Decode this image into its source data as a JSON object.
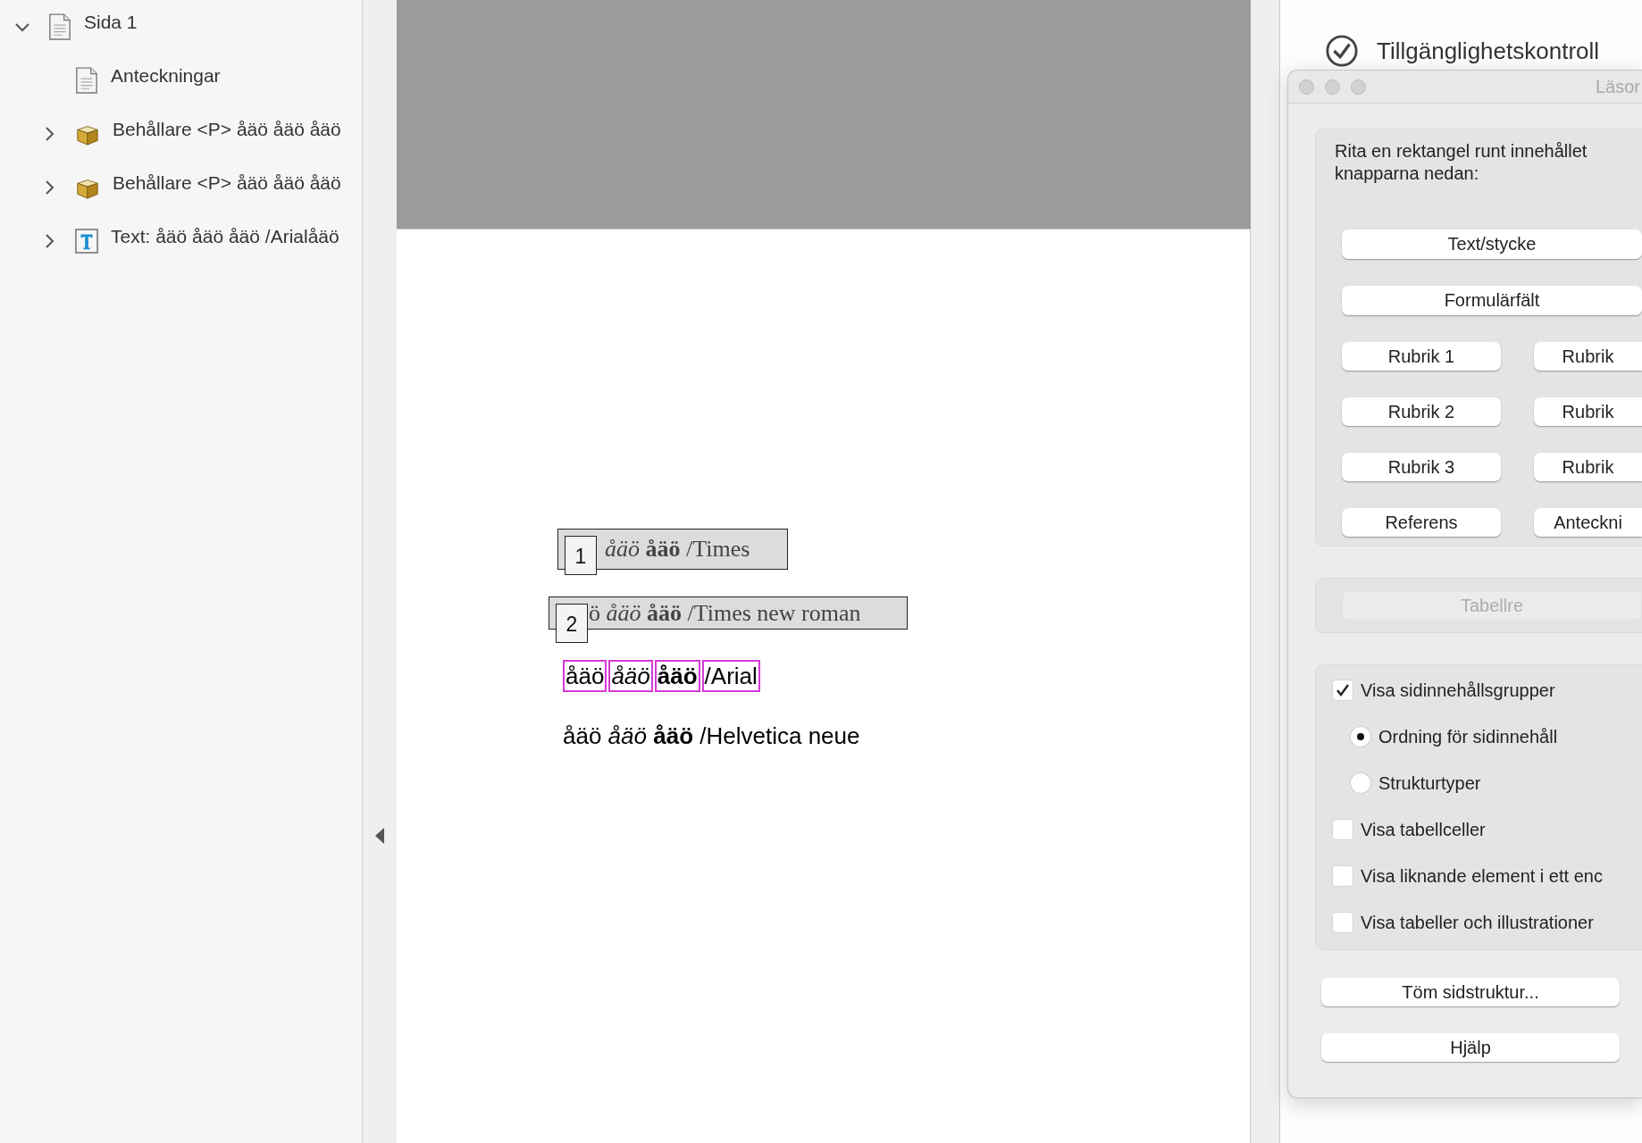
{
  "tree": [
    {
      "label": "Sida 1",
      "kind": "page",
      "expanded": true,
      "children": [
        {
          "label": "Anteckningar",
          "kind": "page"
        },
        {
          "label": "Behållare <P> åäö åäö åäö",
          "kind": "container",
          "expanded": false
        },
        {
          "label": "Behållare <P> åäö åäö åäö",
          "kind": "container",
          "expanded": false
        },
        {
          "label": "Text: åäö åäö åäö /Arialåäö",
          "kind": "text",
          "expanded": false
        }
      ]
    }
  ],
  "document": {
    "lines": [
      {
        "kind": "tagged",
        "tag": "1",
        "text": "*åäö* **åäö** /Times"
      },
      {
        "kind": "tagged",
        "tag": "2",
        "text": "ö *åäö* **åäö** /Times new roman"
      },
      {
        "kind": "boxed",
        "words": [
          "åäö",
          "*åäö*",
          "**åäö**",
          "/Arial"
        ]
      },
      {
        "kind": "plain",
        "text": "åäö *åäö* **åäö** /Helvetica neue"
      }
    ]
  },
  "tools_panel": {
    "items": [
      "Tillgänglighetskontroll"
    ]
  },
  "dialog": {
    "title": "Läsor",
    "instructions": "Rita en rektangel runt innehållet knapparna nedan:",
    "wide_buttons": [
      "Text/stycke",
      "Formulärfält"
    ],
    "grid_buttons": [
      "Rubrik 1",
      "Rubrik",
      "Rubrik 2",
      "Rubrik",
      "Rubrik 3",
      "Rubrik",
      "Referens",
      "Anteckni"
    ],
    "table_button": {
      "label": "Tabellre",
      "disabled": true
    },
    "options": [
      {
        "kind": "checkbox",
        "label": "Visa sidinnehållsgrupper",
        "checked": true
      },
      {
        "kind": "radio",
        "label": "Ordning för sidinnehåll",
        "selected": true
      },
      {
        "kind": "radio",
        "label": "Strukturtyper",
        "selected": false
      },
      {
        "kind": "checkbox",
        "label": "Visa tabellceller",
        "checked": false
      },
      {
        "kind": "checkbox",
        "label": "Visa liknande element i ett enc",
        "checked": false
      },
      {
        "kind": "checkbox",
        "label": "Visa tabeller och illustrationer",
        "checked": false
      }
    ],
    "bottom_buttons": [
      "Töm sidstruktur...",
      "Hjälp"
    ]
  }
}
